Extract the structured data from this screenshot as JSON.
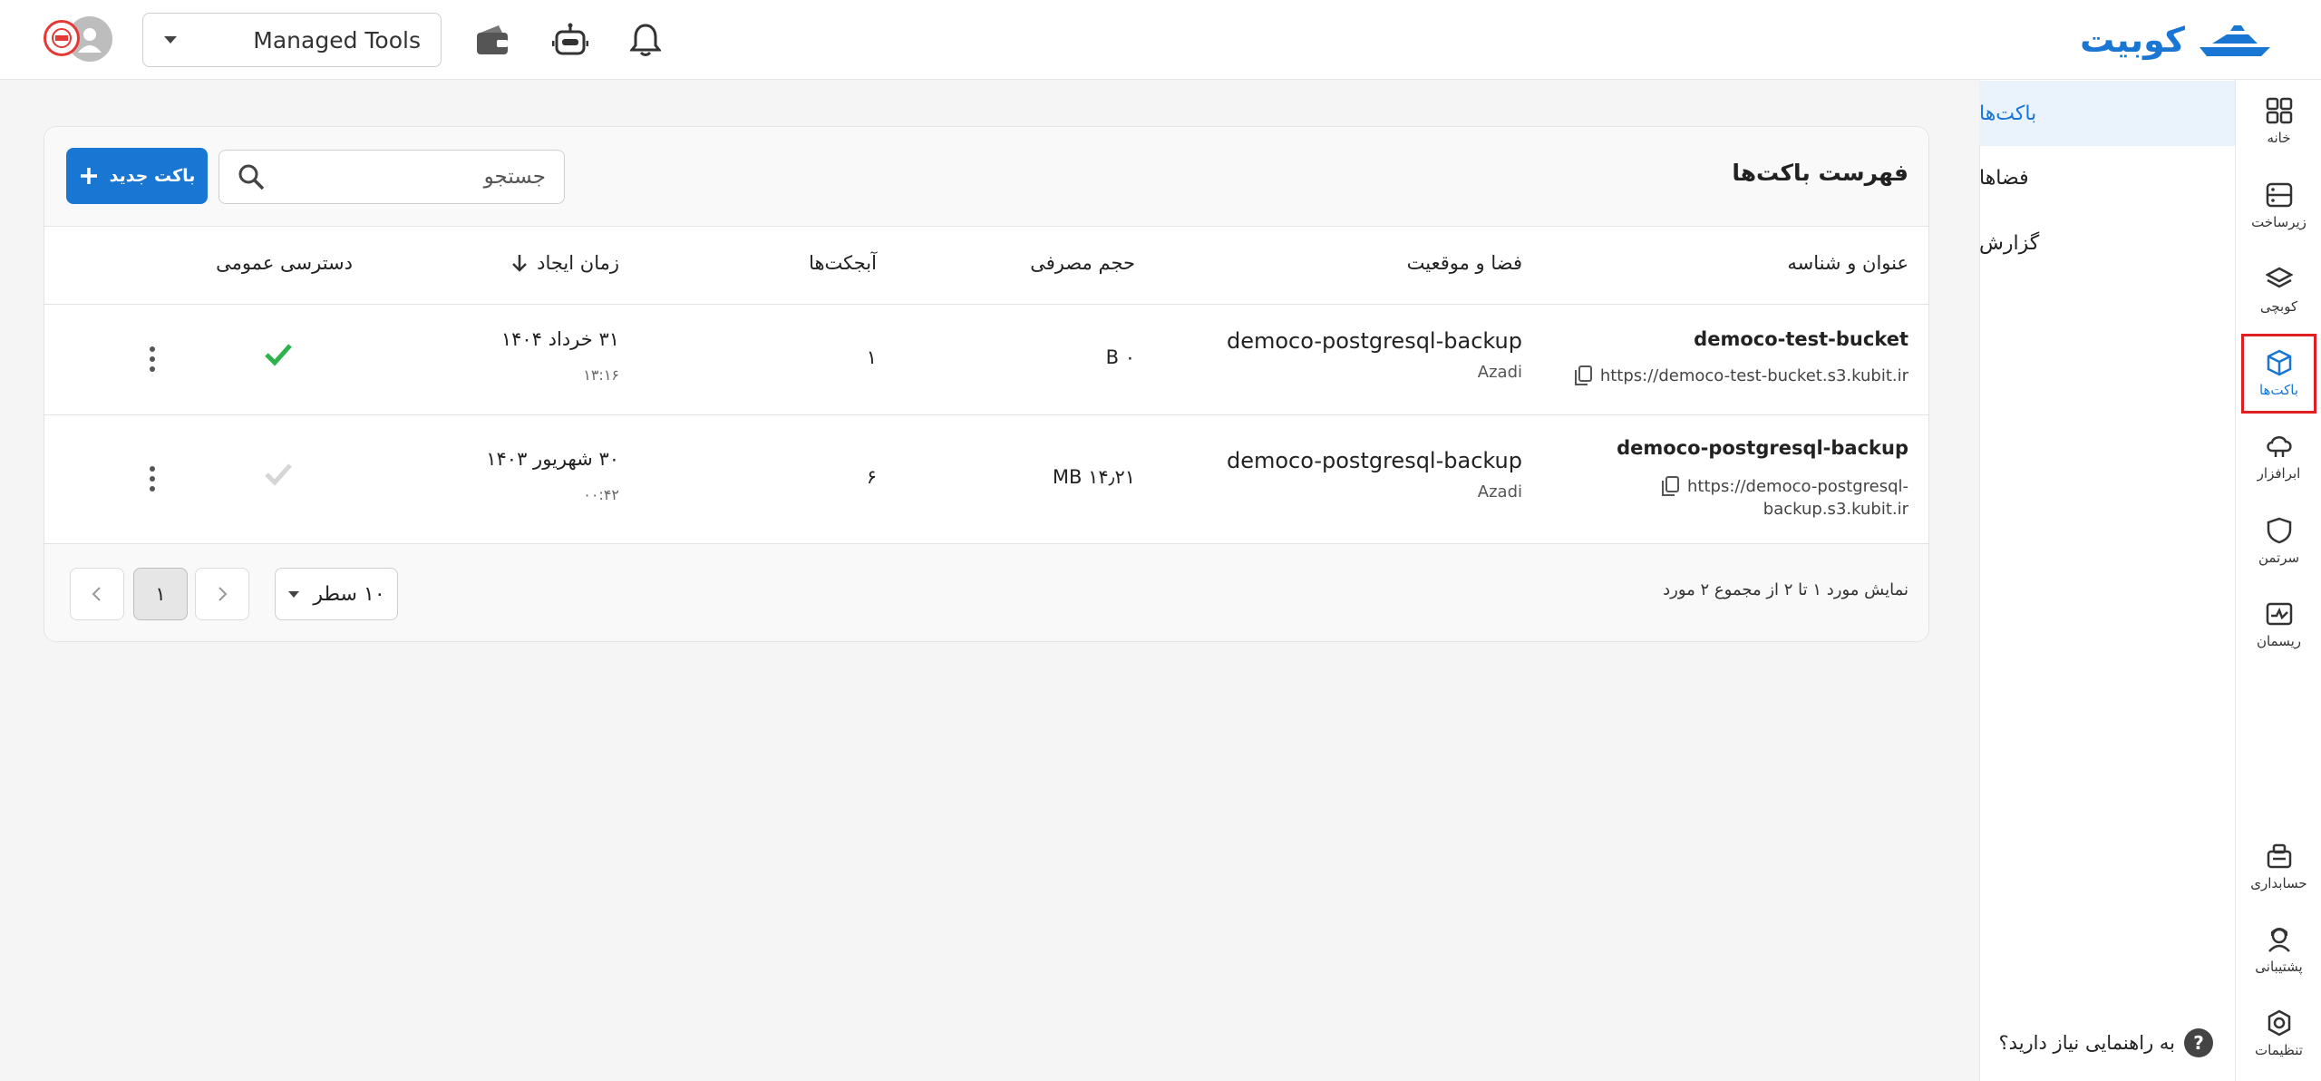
{
  "header": {
    "logo_text": "کوبیت",
    "project_select_value": "Managed Tools"
  },
  "rail": [
    {
      "label": "خانه",
      "icon": "grid-icon"
    },
    {
      "label": "زیرساخت",
      "icon": "server-icon"
    },
    {
      "label": "کوبچی",
      "icon": "layers-icon"
    },
    {
      "label": "باکت‌ها",
      "icon": "cube-icon",
      "active": true
    },
    {
      "label": "ابرافزار",
      "icon": "cloud-app-icon"
    },
    {
      "label": "سرتمن",
      "icon": "shield-icon"
    },
    {
      "label": "ریسمان",
      "icon": "network-icon"
    },
    {
      "label": "حسابداری",
      "icon": "accounting-icon"
    },
    {
      "label": "پشتیبانی",
      "icon": "support-icon"
    },
    {
      "label": "تنظیمات",
      "icon": "settings-icon"
    }
  ],
  "subnav": {
    "items": [
      "باکت‌ها",
      "فضاها",
      "گزارش"
    ],
    "active": "باکت‌ها",
    "help_text": "به راهنمایی نیاز دارید؟",
    "help_mark": "?"
  },
  "buckets": {
    "title": "فهرست باکت‌ها",
    "search_placeholder": "جستجو",
    "new_button": "باکت جدید",
    "columns": {
      "name": "عنوان و شناسه",
      "space": "فضا و موقعیت",
      "usage": "حجم مصرفی",
      "objects": "آبجکت‌ها",
      "created": "زمان ایجاد",
      "public": "دسترسی عمومی"
    },
    "rows": [
      {
        "name": "democo-test-bucket",
        "url": "https://democo-test-bucket.s3.kubit.ir",
        "space": "democo-postgresql-backup",
        "location": "Azadi",
        "usage": "۰ B",
        "objects": "۱",
        "date": "۳۱ خرداد ۱۴۰۴",
        "time": "۱۳:۱۶",
        "public_access": true
      },
      {
        "name": "democo-postgresql-backup",
        "url_line1": "https://democo-postgresql-",
        "url_line2": "backup.s3.kubit.ir",
        "space": "democo-postgresql-backup",
        "location": "Azadi",
        "usage": "۱۴٫۲۱ MB",
        "objects": "۶",
        "date": "۳۰ شهریور ۱۴۰۳",
        "time": "۰۰:۴۲",
        "public_access": false
      }
    ],
    "footer": {
      "summary": "نمایش مورد ۱ تا ۲ از مجموع ۲ مورد",
      "rows_per_page": "۱۰ سطر",
      "current_page": "۱"
    }
  },
  "colors": {
    "accent": "#1976d2",
    "success": "#2eb24b",
    "highlight": "#e02020"
  }
}
